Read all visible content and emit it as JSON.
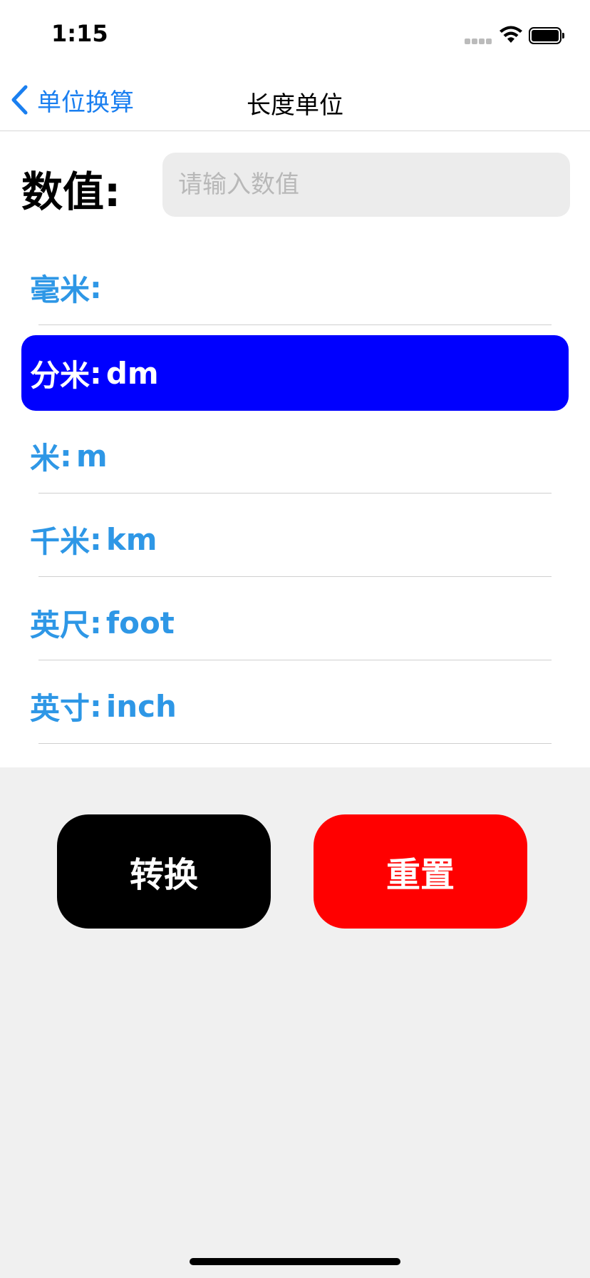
{
  "status_bar": {
    "time": "1:15"
  },
  "nav": {
    "back_label": "单位换算",
    "title": "长度单位"
  },
  "value": {
    "label": "数值:",
    "placeholder": "请输入数值",
    "current": ""
  },
  "units": [
    {
      "name": "毫米",
      "code": "",
      "selected": false
    },
    {
      "name": "分米",
      "code": "dm",
      "selected": true
    },
    {
      "name": "米",
      "code": "m",
      "selected": false
    },
    {
      "name": "千米",
      "code": "km",
      "selected": false
    },
    {
      "name": "英尺",
      "code": "foot",
      "selected": false
    },
    {
      "name": "英寸",
      "code": "inch",
      "selected": false
    }
  ],
  "unit_separator": ":",
  "actions": {
    "convert_label": "转换",
    "reset_label": "重置"
  },
  "colors": {
    "accent": "#2e97e6",
    "back_blue": "#1a7ff0",
    "selected_bg": "#0000ff",
    "convert_bg": "#000000",
    "reset_bg": "#ff0000"
  }
}
